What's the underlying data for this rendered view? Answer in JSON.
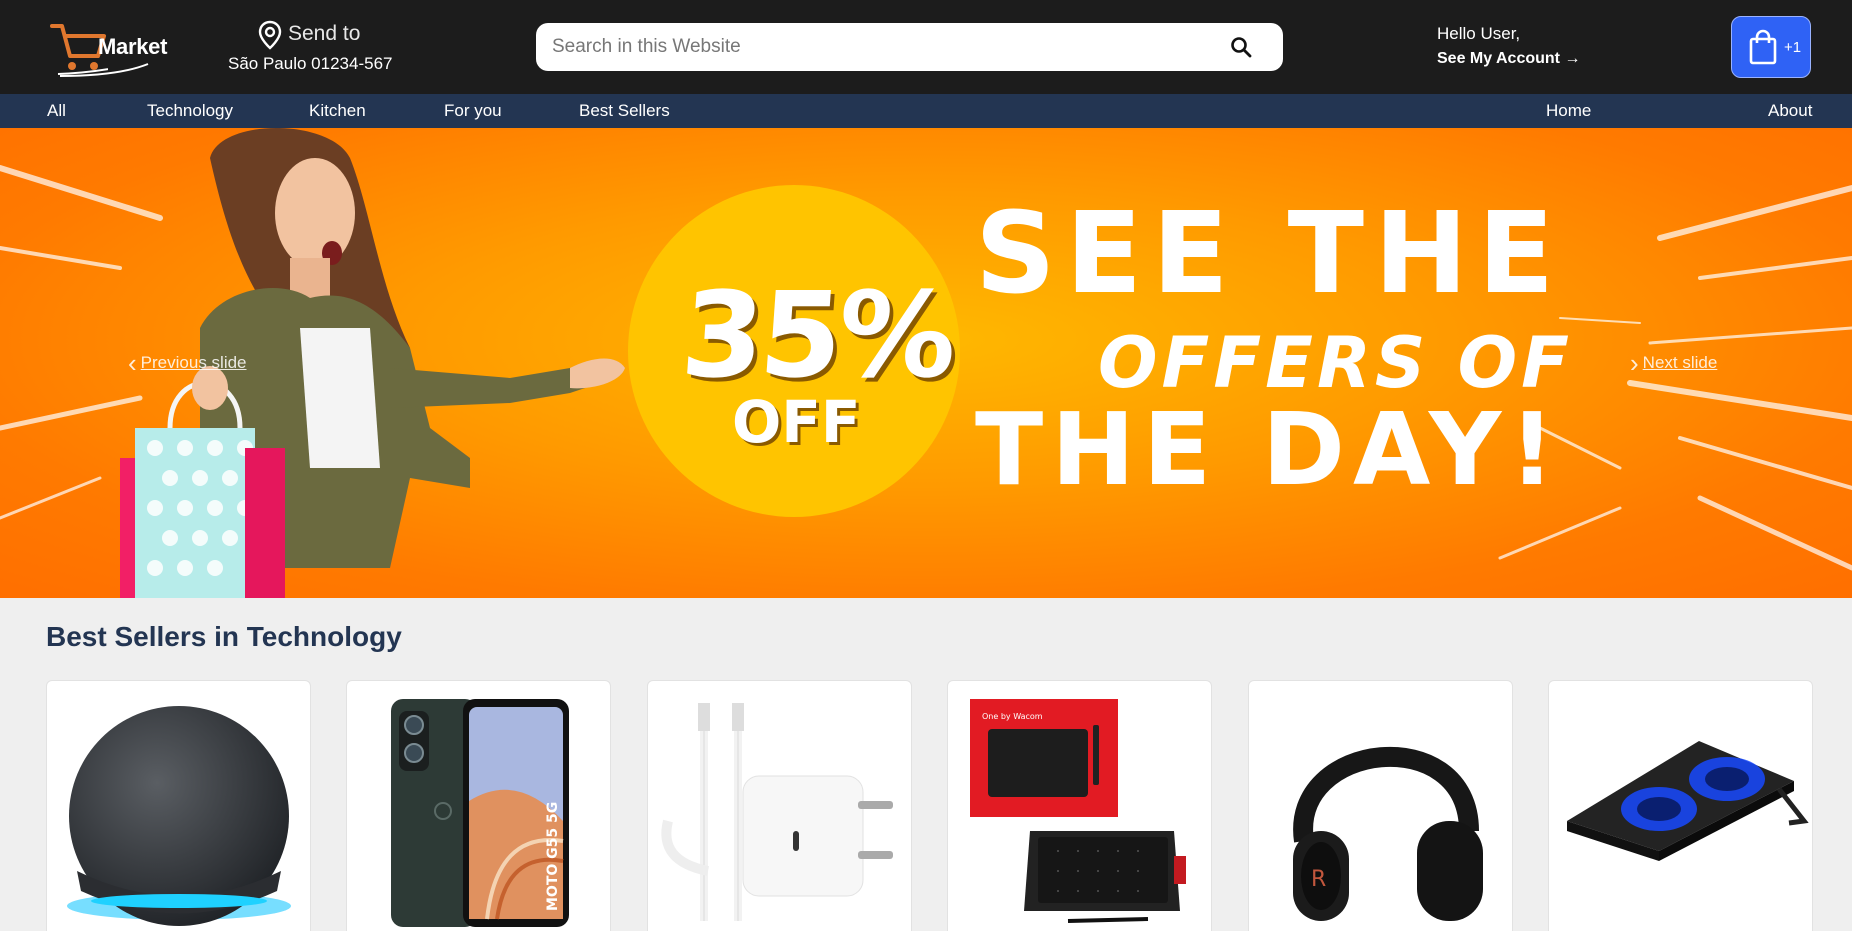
{
  "header": {
    "logo_text": "Market",
    "send_to_label": "Send to",
    "address": "São Paulo 01234-567",
    "search_placeholder": "Search in this Website",
    "greeting": "Hello User,",
    "account_link": "See My Account →",
    "cart_count": "+1"
  },
  "nav": {
    "left": [
      "All",
      "Technology",
      "Kitchen",
      "For you",
      "Best Sellers"
    ],
    "right": [
      "Home",
      "About"
    ]
  },
  "banner": {
    "percent": "35%",
    "off": "OFF",
    "line1": "SEE THE",
    "line2": "OFFERS OF",
    "line3": "THE DAY!",
    "prev": "Previous slide",
    "next": "Next slide"
  },
  "section": {
    "title": "Best Sellers in Technology",
    "products": [
      {
        "icon": "smart-speaker"
      },
      {
        "icon": "smartphone"
      },
      {
        "icon": "charger-cable"
      },
      {
        "icon": "drawing-tablet"
      },
      {
        "icon": "headphones"
      },
      {
        "icon": "laptop-cooler"
      }
    ]
  },
  "colors": {
    "header_bg": "#1c1c1c",
    "nav_bg": "#233552",
    "accent": "#2f62f5",
    "banner_orange": "#ff8a00",
    "circle_yellow": "#ffc400"
  }
}
